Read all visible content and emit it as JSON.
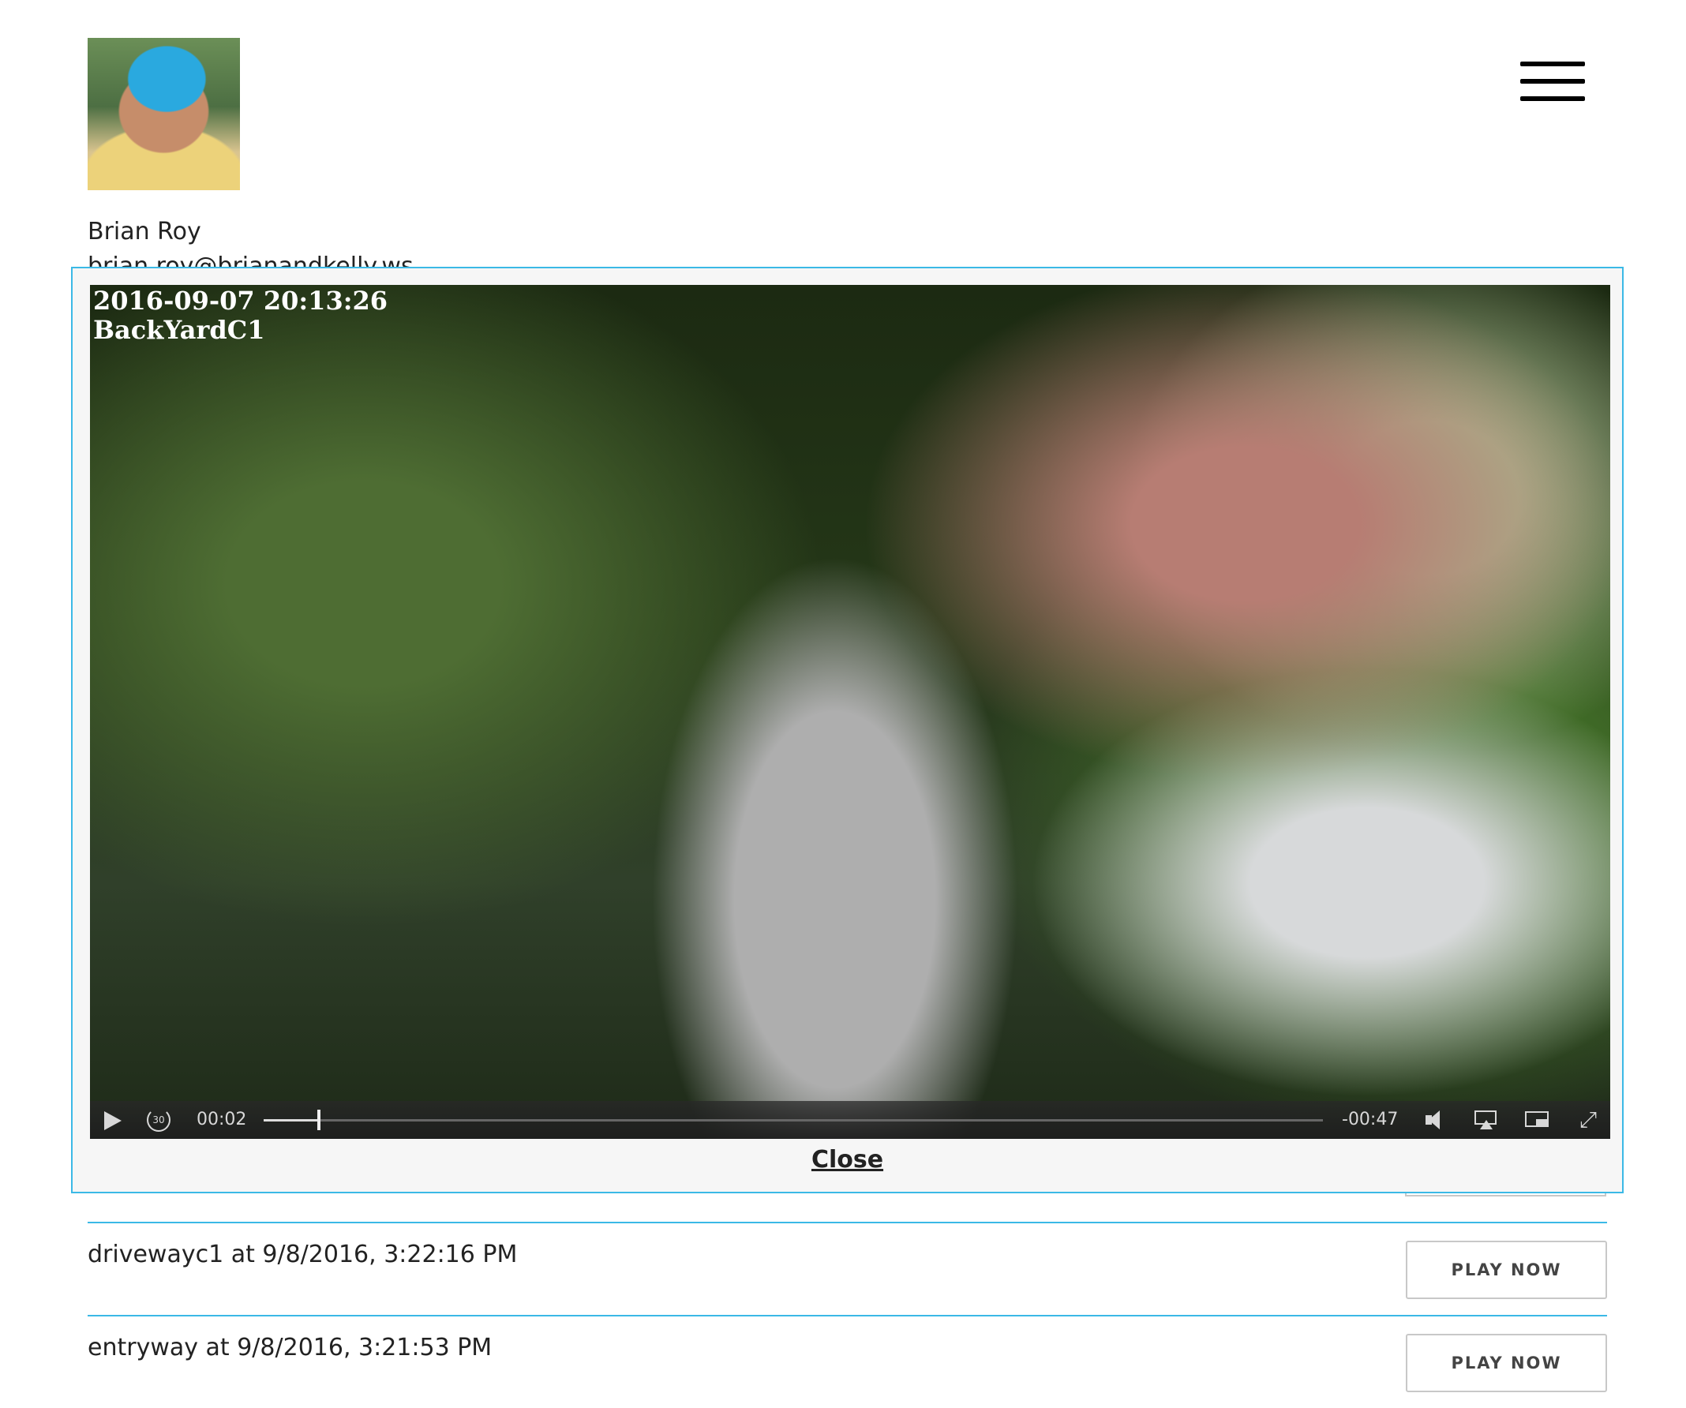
{
  "user": {
    "name": "Brian Roy",
    "email": "brian.roy@brianandkelly.ws"
  },
  "video": {
    "overlay_timestamp": "2016-09-07 20:13:26",
    "overlay_camera": "BackYardC1",
    "skip_seconds": "30",
    "time_elapsed": "00:02",
    "time_remaining": "-00:47",
    "progress": 0.052,
    "fullscreen_glyph": "⤢"
  },
  "modal": {
    "close_label": "Close"
  },
  "recordings": [
    {
      "label": "drivewayc1 at 9/8/2016, 3:22:16 PM",
      "button": "PLAY NOW"
    },
    {
      "label": "entryway at 9/8/2016, 3:21:53 PM",
      "button": "PLAY NOW"
    }
  ],
  "colors": {
    "accent": "#3bb9e6",
    "text": "#222222",
    "button_border": "#c8c8c8"
  },
  "icons": [
    "menu-icon",
    "play-icon",
    "skip-back-30-icon",
    "volume-icon",
    "airplay-icon",
    "pip-icon",
    "fullscreen-icon"
  ]
}
